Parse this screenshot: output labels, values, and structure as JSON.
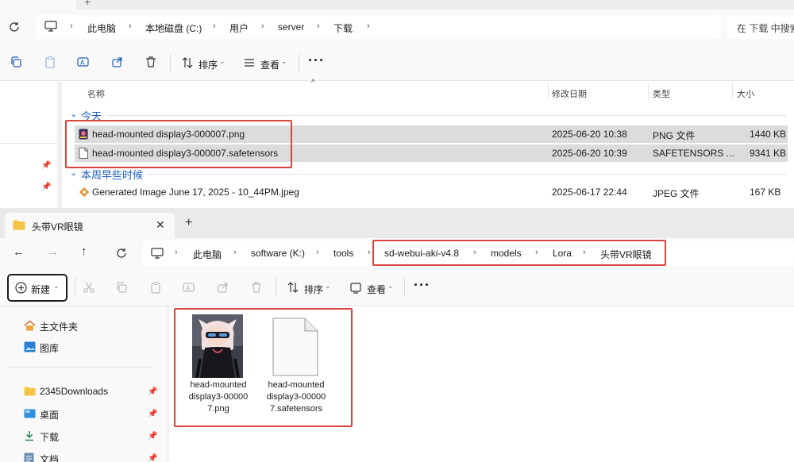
{
  "back_window": {
    "breadcrumb": [
      "此电脑",
      "本地磁盘 (C:)",
      "用户",
      "server",
      "下载"
    ],
    "search_placeholder": "在 下载 中搜索",
    "toolbar": {
      "sort_label": "排序",
      "view_label": "查看"
    },
    "columns": {
      "name": "名称",
      "modified": "修改日期",
      "type": "类型",
      "size": "大小"
    },
    "groups": {
      "today": "今天",
      "earlier_this_week": "本周早些时候"
    },
    "files": [
      {
        "name": "head-mounted display3-000007.png",
        "date": "2025-06-20 10:38",
        "type": "PNG 文件",
        "size": "1440 KB"
      },
      {
        "name": "head-mounted display3-000007.safetensors",
        "date": "2025-06-20 10:39",
        "type": "SAFETENSORS ...",
        "size": "9341 KB"
      },
      {
        "name": "Generated Image June 17, 2025 - 10_44PM.jpeg",
        "date": "2025-06-17 22:44",
        "type": "JPEG 文件",
        "size": "167 KB"
      }
    ]
  },
  "front_window": {
    "tab_title": "头带VR眼镜",
    "breadcrumb": [
      "此电脑",
      "software (K:)",
      "tools",
      "sd-webui-aki-v4.8",
      "models",
      "Lora",
      "头带VR眼镜"
    ],
    "toolbar": {
      "new_label": "新建",
      "sort_label": "排序",
      "view_label": "查看"
    },
    "nav": [
      {
        "label": "主文件夹",
        "icon": "home-icon"
      },
      {
        "label": "图库",
        "icon": "gallery-icon"
      },
      {
        "label": "2345Downloads",
        "icon": "folder-icon"
      },
      {
        "label": "桌面",
        "icon": "desktop-icon"
      },
      {
        "label": "下载",
        "icon": "download-icon"
      },
      {
        "label": "文档",
        "icon": "document-icon"
      }
    ],
    "files": [
      {
        "label": "head-mounted display3-000007.png",
        "lines": [
          "head-mounted",
          "display3-00000",
          "7.png"
        ]
      },
      {
        "label": "head-mounted display3-000007.safetensors",
        "lines": [
          "head-mounted",
          "display3-00000",
          "7.safetensors"
        ]
      }
    ]
  },
  "colors": {
    "highlight_red": "#d9453d",
    "accent_blue": "#1f5fbf",
    "selection_gray": "#dcdcdc"
  }
}
